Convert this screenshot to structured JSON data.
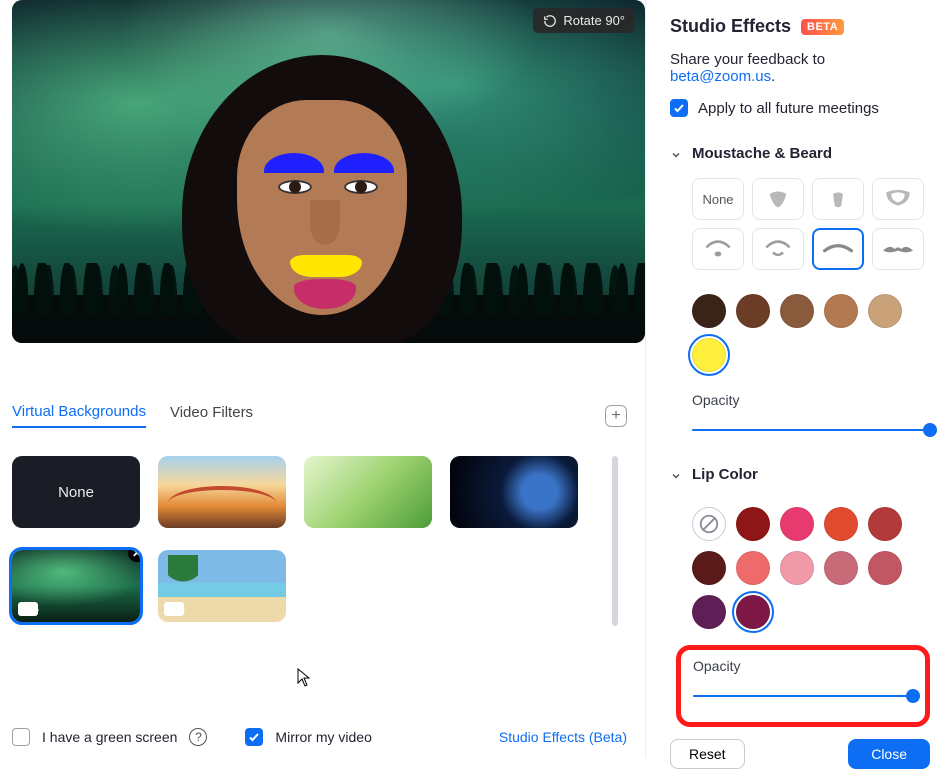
{
  "preview": {
    "rotate_label": "Rotate 90°"
  },
  "tabs": {
    "virtual_backgrounds": "Virtual Backgrounds",
    "video_filters": "Video Filters",
    "active": "virtual_backgrounds"
  },
  "backgrounds": {
    "none_label": "None"
  },
  "bottom": {
    "green_screen_label": "I have a green screen",
    "mirror_label": "Mirror my video",
    "studio_link": "Studio Effects (Beta)"
  },
  "studio": {
    "title": "Studio Effects",
    "beta": "BETA",
    "feedback_prefix": "Share your feedback to  ",
    "feedback_email": "beta@zoom.us",
    "feedback_suffix": ".",
    "apply_all_label": "Apply to all future meetings"
  },
  "moustache_section": {
    "title": "Moustache & Beard",
    "none_label": "None",
    "colors": [
      "#3a2418",
      "#6b3c26",
      "#8a5a3c",
      "#b37a52",
      "#c9a27a",
      "#ffef3c"
    ],
    "selected_color_index": 5,
    "opacity_label": "Opacity",
    "opacity_value": 100
  },
  "lip_section": {
    "title": "Lip Color",
    "colors_row1": [
      "none",
      "#8f1616",
      "#e73b6f",
      "#e24a2e",
      "#b23a3a",
      "#5a1a1a"
    ],
    "colors_row2": [
      "#ef6b6b",
      "#f09aa8",
      "#c86a77",
      "#c25764",
      "#5e1f57",
      "#7d1846"
    ],
    "selected_color_index": 11,
    "opacity_label": "Opacity",
    "opacity_value": 100
  },
  "buttons": {
    "reset": "Reset",
    "close": "Close"
  }
}
